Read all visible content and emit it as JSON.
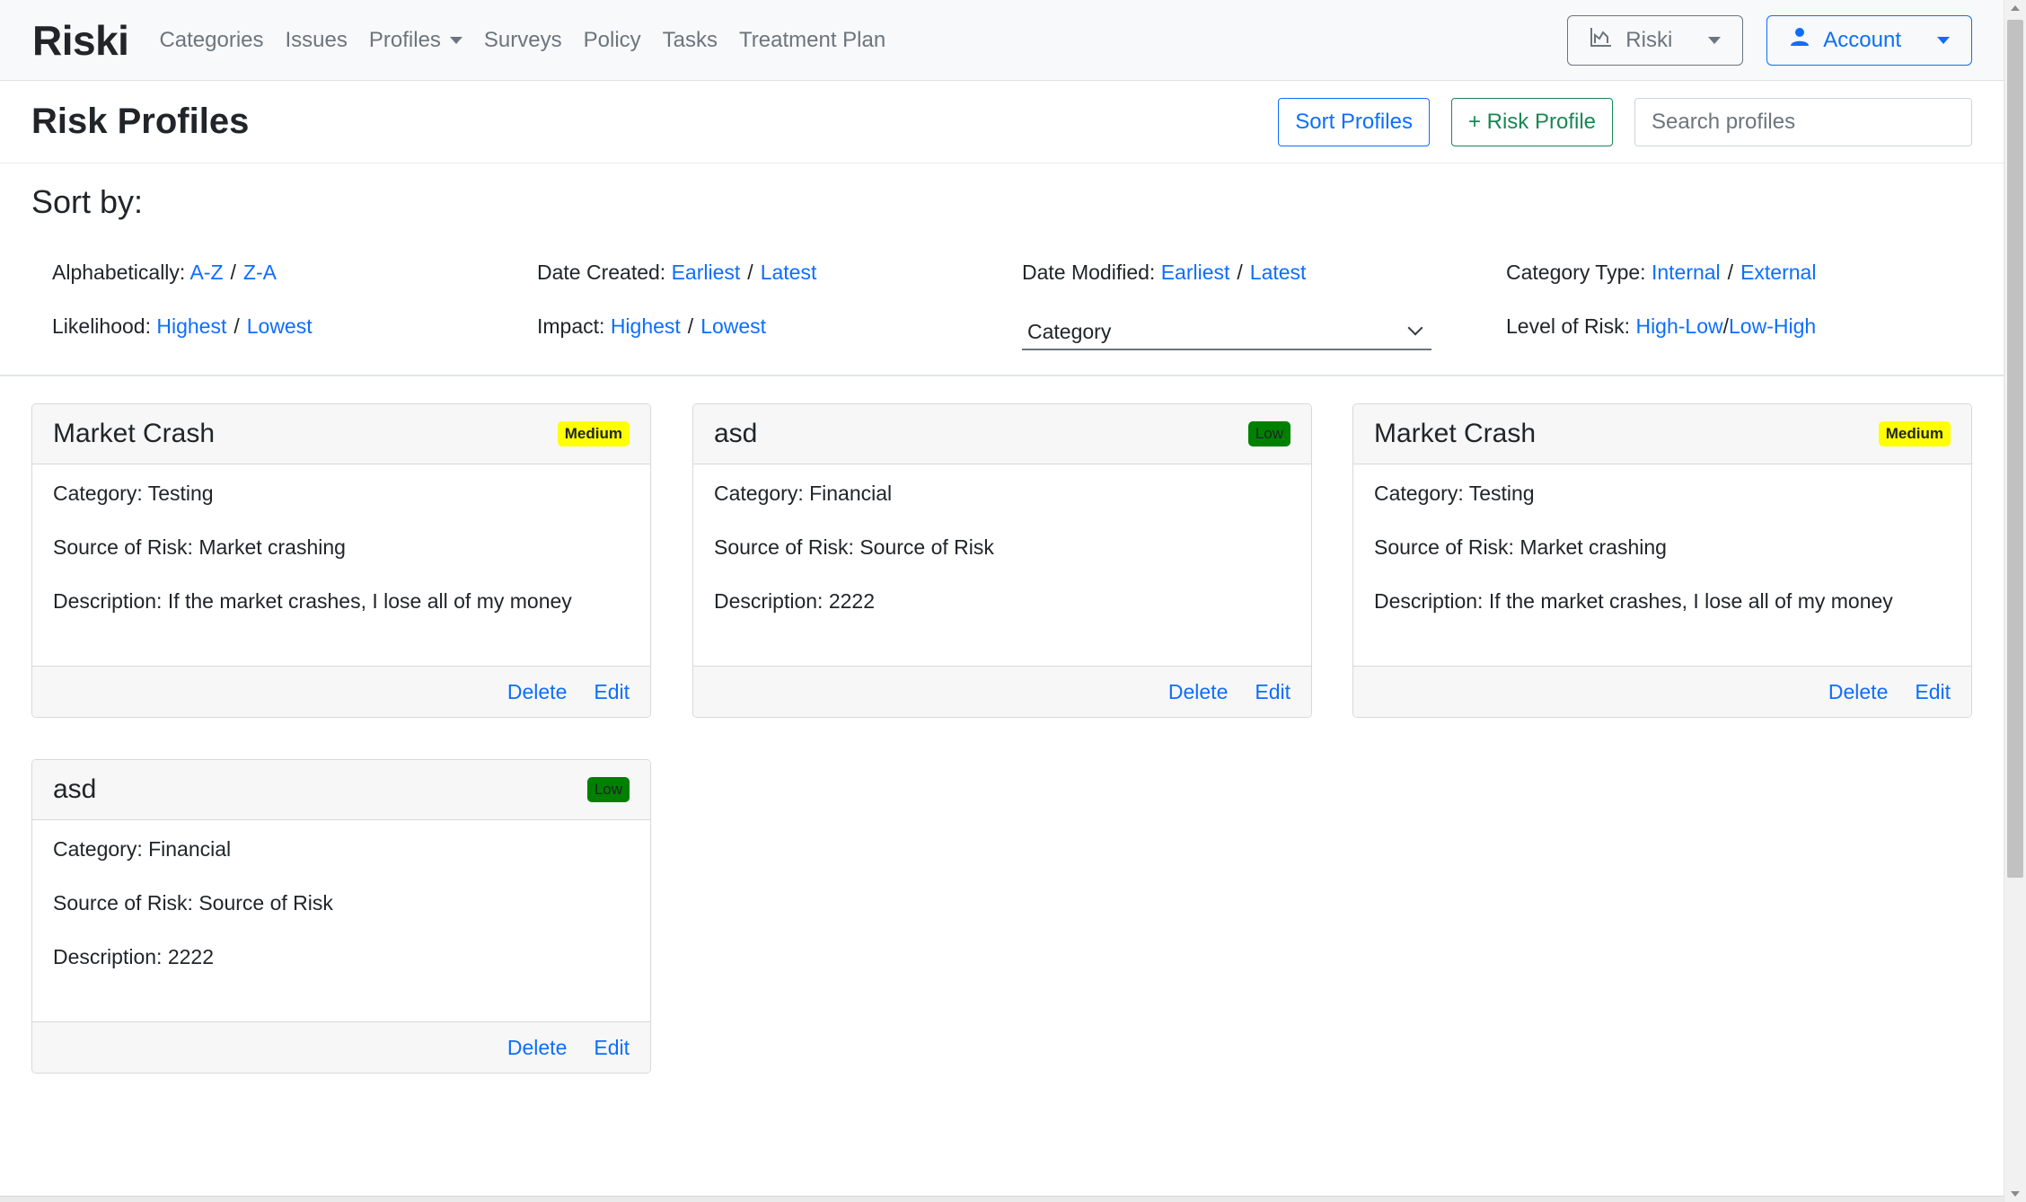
{
  "navbar": {
    "brand": "Riski",
    "links": [
      "Categories",
      "Issues",
      "Profiles",
      "Surveys",
      "Policy",
      "Tasks",
      "Treatment Plan"
    ],
    "app_button": "Riski",
    "account_button": "Account"
  },
  "header": {
    "title": "Risk Profiles",
    "sort_button": "Sort Profiles",
    "add_button": "+ Risk Profile",
    "search_placeholder": "Search profiles"
  },
  "sort": {
    "heading": "Sort by:",
    "alphabetically": {
      "label": "Alphabetically:",
      "a": "A-Z",
      "sep": "/",
      "b": "Z-A"
    },
    "date_created": {
      "label": "Date Created:",
      "a": "Earliest",
      "sep": "/",
      "b": "Latest"
    },
    "date_modified": {
      "label": "Date Modified:",
      "a": "Earliest",
      "sep": "/",
      "b": "Latest"
    },
    "category_type": {
      "label": "Category Type:",
      "a": "Internal",
      "sep": "/",
      "b": "External"
    },
    "likelihood": {
      "label": "Likelihood:",
      "a": "Highest",
      "sep": "/",
      "b": "Lowest"
    },
    "impact": {
      "label": "Impact:",
      "a": "Highest",
      "sep": "/",
      "b": "Lowest"
    },
    "category_select": "Category",
    "level_of_risk": {
      "label": "Level of Risk:",
      "a": "High-Low",
      "sep": "/",
      "b": "Low-High"
    }
  },
  "cards": [
    {
      "title": "Market Crash",
      "badge": "Medium",
      "category": "Category: Testing",
      "source": "Source of Risk: Market crashing",
      "description": "Description: If the market crashes, I lose all of my money",
      "delete": "Delete",
      "edit": "Edit"
    },
    {
      "title": "asd",
      "badge": "Low",
      "category": "Category: Financial",
      "source": "Source of Risk: Source of Risk",
      "description": "Description: 2222",
      "delete": "Delete",
      "edit": "Edit"
    },
    {
      "title": "Market Crash",
      "badge": "Medium",
      "category": "Category: Testing",
      "source": "Source of Risk: Market crashing",
      "description": "Description: If the market crashes, I lose all of my money",
      "delete": "Delete",
      "edit": "Edit"
    },
    {
      "title": "asd",
      "badge": "Low",
      "category": "Category: Financial",
      "source": "Source of Risk: Source of Risk",
      "description": "Description: 2222",
      "delete": "Delete",
      "edit": "Edit"
    }
  ],
  "colors": {
    "primary": "#0d6efd",
    "success": "#198754",
    "badge_medium": "#ffff00",
    "badge_low": "#008000",
    "navbar_bg": "#f8f9fa"
  }
}
